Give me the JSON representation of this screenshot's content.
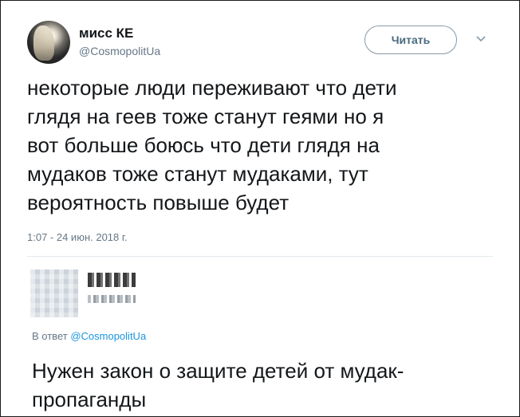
{
  "tweet": {
    "author_name": "мисс КЕ",
    "author_handle": "@CosmopolitUa",
    "follow_label": "Читать",
    "caret_icon": "chevron-down-icon",
    "text": "некоторые люди переживают что дети\nглядя на геев тоже станут геями но я\nвот больше боюсь что дети глядя на\nмудаков тоже станут мудаками, тут\nвероятность повыше будет",
    "timestamp": "1:07 - 24 июн. 2018 г."
  },
  "reply": {
    "in_reply_prefix": "В ответ",
    "in_reply_handle": "@CosmopolitUa",
    "text": "Нужен закон о защите детей от мудак-\nпропаганды"
  },
  "colors": {
    "text": "#14171a",
    "secondary": "#657786",
    "link": "#1b95e0",
    "border": "#e1e8ed"
  }
}
